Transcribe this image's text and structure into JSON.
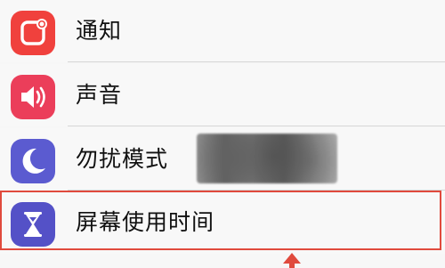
{
  "settings": {
    "items": [
      {
        "label": "通知",
        "icon": "notification-badge-icon",
        "color": "#f0413d"
      },
      {
        "label": "声音",
        "icon": "speaker-icon",
        "color": "#eb3e5a"
      },
      {
        "label": "勿扰模式",
        "icon": "moon-icon",
        "color": "#5b5bd0"
      },
      {
        "label": "屏幕使用时间",
        "icon": "hourglass-icon",
        "color": "#5451c7"
      }
    ]
  },
  "annotation": {
    "highlight_color": "#e04a3d"
  }
}
